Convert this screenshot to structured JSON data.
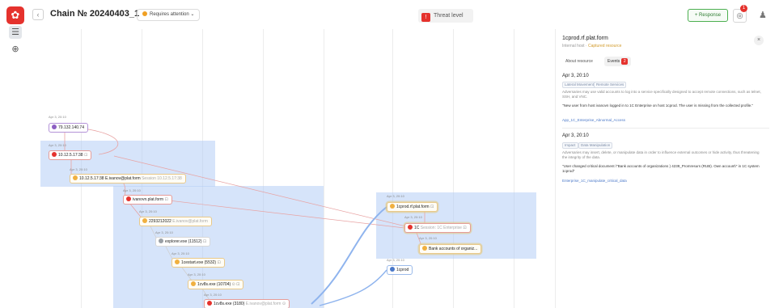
{
  "header": {
    "logo_glyph": "✿",
    "back_glyph": "‹",
    "title": "Chain № 20240403_1",
    "status_label": "Requires attention",
    "status_caret": "⌄",
    "threat_label": "Threat level",
    "threat_glyph": "!",
    "response_label": "+ Response",
    "notif_icon": "◎",
    "notif_count": "1",
    "user_icon": "♟"
  },
  "toolbar": {
    "tool1_glyph": "☰",
    "tool2_glyph": "⊕"
  },
  "graph": {
    "nodes": [
      {
        "time": "Apr 3, 20:10",
        "label": "79.132.140.74",
        "sub": "",
        "action": ""
      },
      {
        "time": "Apr 3, 20:10",
        "label": "10.12.5.17:38",
        "sub": "",
        "action": "⊡"
      },
      {
        "time": "Apr 3, 20:10",
        "label": "10.12.5.17:38 E.ivanov@plat.form",
        "sub": "Session 10.12.5.17:38",
        "action": ""
      },
      {
        "time": "Apr 3, 20:10",
        "label": "ivanovn.plat.form",
        "sub": "",
        "action": "⊡"
      },
      {
        "time": "Apr 3, 20:10",
        "label": "2293212022",
        "sub": "E.ivanov@plat.form",
        "action": ""
      },
      {
        "time": "Apr 3, 20:10",
        "label": "explorer.exe (11512)",
        "sub": "",
        "action": "⊡"
      },
      {
        "time": "Apr 3, 20:10",
        "label": "1cestart.exe (5532)",
        "sub": "",
        "action": "⊡"
      },
      {
        "time": "Apr 3, 20:10",
        "label": "1cv8s.exe (10704)",
        "sub": "",
        "action": "⊙ ⊡"
      },
      {
        "time": "Apr 3, 20:10",
        "label": "1cv8s.exe (3180)",
        "sub": "E.ivanov@plat.form",
        "action": "⊙"
      },
      {
        "time": "Apr 3, 20:10",
        "label": "1cprod.rf.plat.form",
        "sub": "",
        "action": "⊡"
      },
      {
        "time": "Apr 3, 20:10",
        "label": "1C",
        "sub": "Session: 1C Enterprise",
        "action": "⊡"
      },
      {
        "time": "Apr 3, 20:10",
        "label": "Bank accounts of organiz...",
        "sub": "",
        "action": ""
      },
      {
        "time": "Apr 3, 20:10",
        "label": "1cprod",
        "sub": "",
        "action": ""
      }
    ]
  },
  "panel": {
    "close_glyph": "×",
    "title": "1cprod.rf.plat.form",
    "subtitle": "Internal host",
    "subtitle_highlight": "Captured resource",
    "tab_about": "About resource",
    "tab_events": "Events",
    "events_count": "2",
    "events": [
      {
        "date": "Apr 3, 20:10",
        "tags": [
          "Lateral Movement",
          "Remote Services"
        ],
        "description": "Adversaries may use valid accounts to log into a service specifically designed to accept remote connections, such as telnet, SSH, and VNC.",
        "quote": "\"New user from host ivanovn logged in to 1C Enterprise on host 1cprod. The user is missing from the collected profile.\"",
        "rule": "App_1C_Enterprise_Abnormal_Access"
      },
      {
        "date": "Apr 3, 20:10",
        "tags": [
          "Impact",
          "Data Manipulation"
        ],
        "description": "Adversaries may insert, delete, or manipulate data in order to influence external outcomes or hide activity, thus threatening the integrity of the data.",
        "quote": "\"User changed critical document \\\"Bank accounts of organizations ) 4239_Promresurs (RUB). Own account\\\" in 1C system 1cprod\"",
        "rule": "Enterprise_1C_manipulate_critical_data"
      }
    ]
  }
}
